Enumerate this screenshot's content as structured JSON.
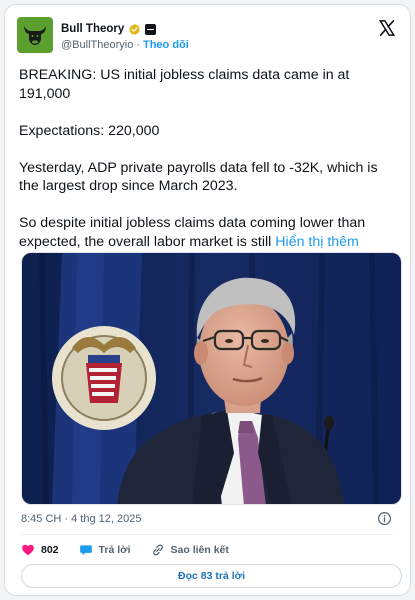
{
  "author": {
    "display_name": "Bull Theory",
    "handle": "@BullTheoryio",
    "separator": "·",
    "follow_label": "Theo dõi"
  },
  "tweet": {
    "lines": [
      "BREAKING: US initial jobless claims data came in at 191,000",
      "Expectations: 220,000",
      "Yesterday, ADP private payrolls data fell to -32K, which is the largest drop since March 2023.",
      "So despite initial jobless claims data coming lower than expected, the overall labor market is still "
    ],
    "show_more_label": "Hiển thị thêm"
  },
  "meta": {
    "timestamp": "8:45 CH · 4 thg 12, 2025"
  },
  "actions": {
    "likes": "802",
    "reply_label": "Trả lời",
    "copy_link_label": "Sao liên kết"
  },
  "read_replies_label": "Đọc 83 trả lời",
  "colors": {
    "accent": "#1d9bf0",
    "like": "#f91880",
    "reply": "#1d9bf0",
    "avatar_bg": "#5ba02e"
  },
  "icons": [
    "bull-logo-icon",
    "verified-badge-icon",
    "affiliate-badge-icon",
    "x-logo-icon",
    "info-icon",
    "heart-icon",
    "reply-icon",
    "link-icon"
  ]
}
